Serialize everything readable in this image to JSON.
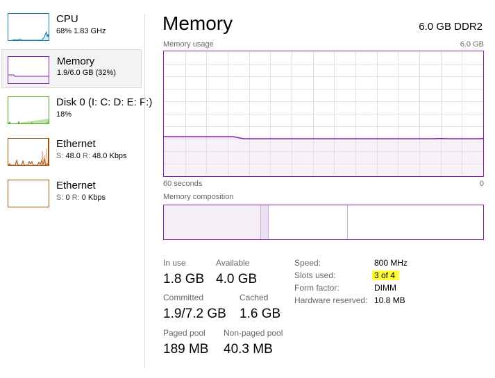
{
  "sidebar": {
    "items": [
      {
        "title": "CPU",
        "sub": "68% 1.83 GHz",
        "color": "#1179b4",
        "selected": false
      },
      {
        "title": "Memory",
        "sub": "1.9/6.0 GB (32%)",
        "color": "#8b1fb0",
        "selected": true
      },
      {
        "title": "Disk 0 (I: C: D: E: F:)",
        "sub": "18%",
        "color": "#4ea017",
        "selected": false
      },
      {
        "title": "Ethernet",
        "sub_s_label": "S:",
        "sub_s": "48.0",
        "sub_r_label": "R:",
        "sub_r": "48.0 Kbps",
        "color": "#a74f01",
        "selected": false
      },
      {
        "title": "Ethernet",
        "sub_s_label": "S:",
        "sub_s": "0",
        "sub_r_label": "R:",
        "sub_r": "0 Kbps",
        "color": "#a74f01",
        "selected": false
      }
    ]
  },
  "header": {
    "title": "Memory",
    "capacity": "6.0 GB DDR2"
  },
  "usage_graph": {
    "label": "Memory usage",
    "max_label": "6.0 GB",
    "x_left_label": "60 seconds",
    "x_right_label": "0",
    "color": "#8b1fb0",
    "fill_color": "#f3eff5",
    "grid_color": "#ead8f0"
  },
  "composition": {
    "label": "Memory composition",
    "segments": [
      {
        "name": "in-use",
        "fraction": 0.305,
        "fill": "#f3eff5"
      },
      {
        "name": "modified",
        "fraction": 0.024,
        "fill": "#eee1f3"
      },
      {
        "name": "standby",
        "fraction": 0.247,
        "fill": "#ffffff"
      },
      {
        "name": "free",
        "fraction": 0.424,
        "fill": "#ffffff"
      }
    ]
  },
  "stats": {
    "in_use": {
      "label": "In use",
      "value": "1.8 GB"
    },
    "available": {
      "label": "Available",
      "value": "4.0 GB"
    },
    "committed": {
      "label": "Committed",
      "value": "1.9/7.2 GB"
    },
    "cached": {
      "label": "Cached",
      "value": "1.6 GB"
    },
    "paged_pool": {
      "label": "Paged pool",
      "value": "189 MB"
    },
    "non_paged_pool": {
      "label": "Non-paged pool",
      "value": "40.3 MB"
    }
  },
  "details": {
    "speed": {
      "label": "Speed:",
      "value": "800 MHz"
    },
    "slots": {
      "label": "Slots used:",
      "value": "3 of 4"
    },
    "form_factor": {
      "label": "Form factor:",
      "value": "DIMM"
    },
    "hw_reserved": {
      "label": "Hardware reserved:",
      "value": "10.8 MB"
    }
  },
  "chart_data": {
    "type": "area",
    "title": "Memory usage",
    "xlabel": "60 seconds",
    "ylabel": "",
    "x": [
      60,
      50,
      47,
      45,
      40,
      30,
      20,
      10,
      8,
      6,
      5,
      3,
      1,
      0
    ],
    "values": [
      1.9,
      1.9,
      1.9,
      1.8,
      1.8,
      1.8,
      1.8,
      1.8,
      1.81,
      1.8,
      1.8,
      1.8,
      1.8,
      1.81
    ],
    "xlim": [
      60,
      0
    ],
    "ylim": [
      0,
      6.0
    ],
    "grid": true,
    "unit": "GB"
  }
}
